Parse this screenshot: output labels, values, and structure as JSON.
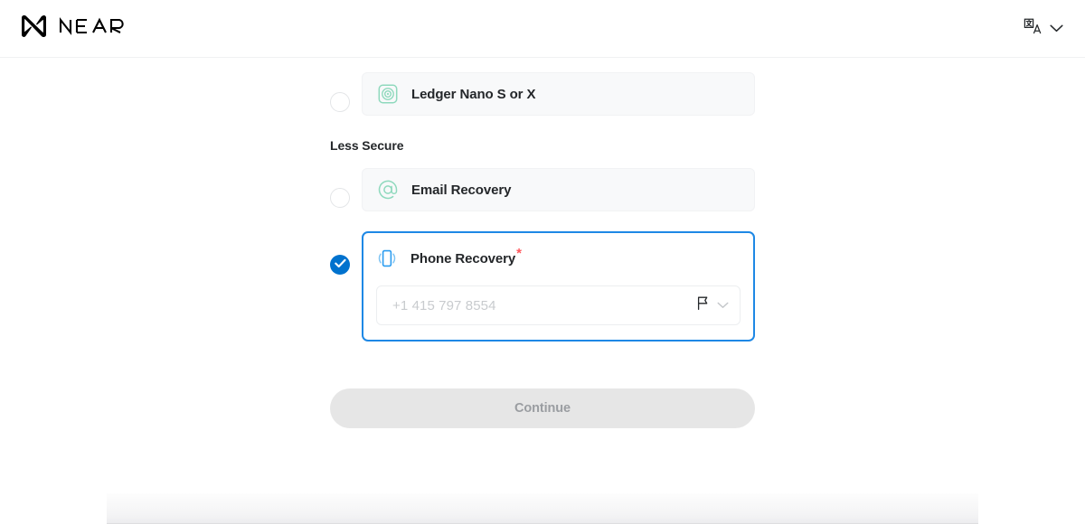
{
  "header": {
    "brand_name": "NEAR",
    "brand_logo_icon": "near-logo-icon",
    "language": {
      "icon": "translate-icon",
      "chevron": "chevron-down-icon"
    }
  },
  "main": {
    "options_top": [
      {
        "id": "ledger",
        "label": "Ledger Nano S or X",
        "icon": "ledger-device-icon",
        "icon_color": "#8fd9bd",
        "selected": false
      }
    ],
    "section_heading": "Less Secure",
    "options_less_secure": [
      {
        "id": "email-recovery",
        "label": "Email Recovery",
        "icon": "at-sign-icon",
        "icon_color": "#8fd9bd",
        "selected": false
      },
      {
        "id": "phone-recovery",
        "label": "Phone Recovery",
        "required_marker": "*",
        "icon": "phone-vibrate-icon",
        "icon_color": "#2b9cf0",
        "selected": true
      }
    ],
    "phone_field": {
      "value": "",
      "placeholder": "+1 415 797 8554",
      "flag_icon": "flag-icon",
      "chevron_icon": "chevron-down-icon"
    },
    "continue_label": "Continue",
    "continue_disabled": true
  },
  "colors": {
    "accent_blue": "#0072ce",
    "selected_border": "#1e88e5",
    "required_red": "#ff585d",
    "green_icon": "#8fd9bd",
    "card_bg": "#f8f9fa",
    "disabled_btn_bg": "#e6e6e6",
    "disabled_btn_text": "#9a9da1"
  }
}
